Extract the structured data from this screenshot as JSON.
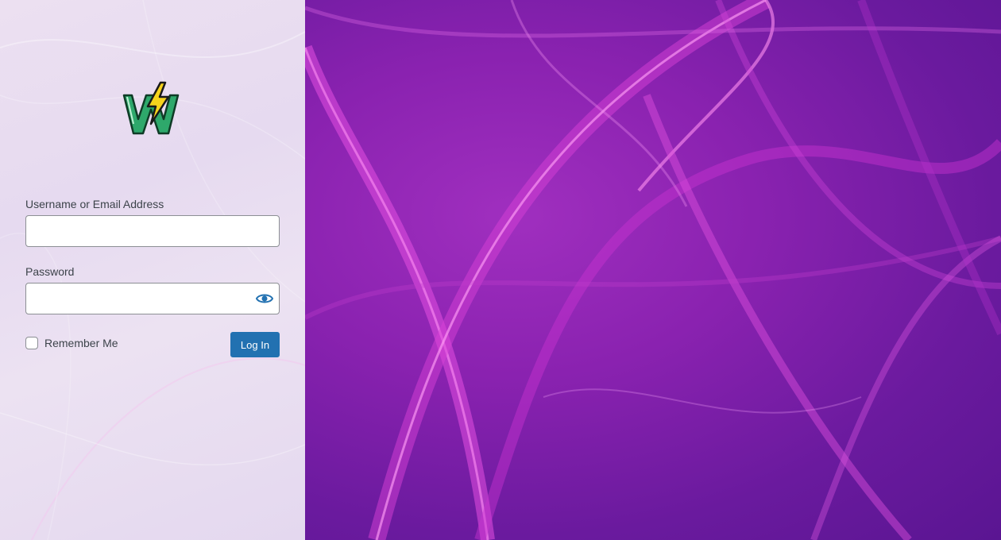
{
  "login": {
    "username_label": "Username or Email Address",
    "username_value": "",
    "password_label": "Password",
    "password_value": "",
    "remember_label": "Remember Me",
    "remember_checked": false,
    "submit_label": "Log In"
  },
  "icons": {
    "logo": "site-logo-w-lightning-icon",
    "password_toggle": "eye-icon"
  },
  "colors": {
    "accent": "#2271b1",
    "panel_bg": "#e8dcf0",
    "background_purple": "#8a22b0",
    "background_pink": "#e040d8"
  }
}
